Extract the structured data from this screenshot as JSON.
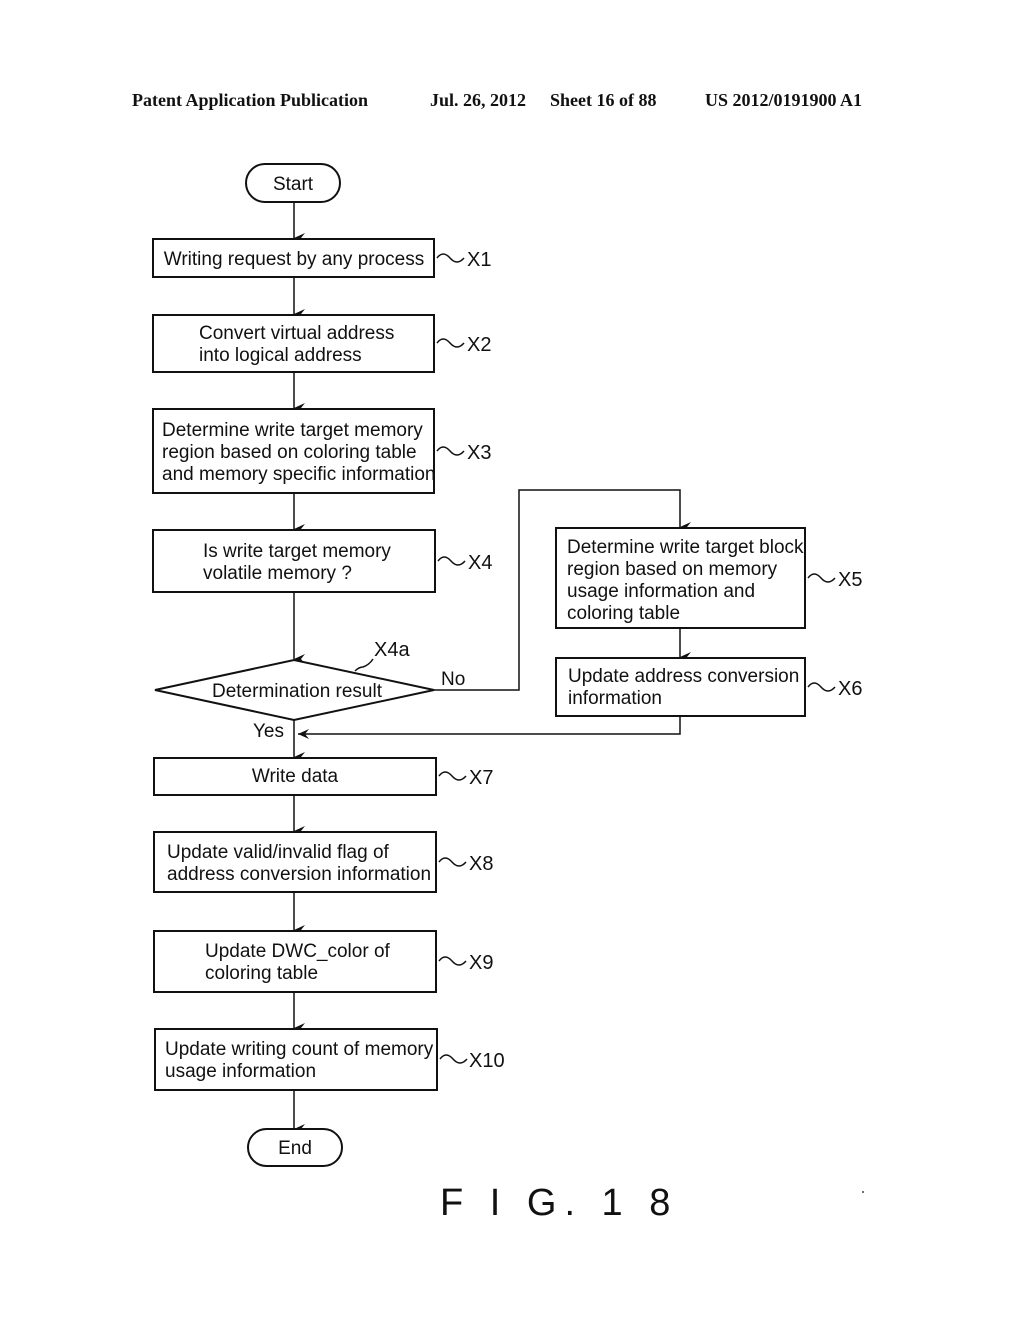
{
  "header": {
    "publication": "Patent Application Publication",
    "date": "Jul. 26, 2012",
    "sheet": "Sheet 16 of 88",
    "number": "US 2012/0191900 A1"
  },
  "flowchart": {
    "start": "Start",
    "end": "End",
    "steps": {
      "x1": {
        "ref": "X1",
        "lines": [
          "Writing request by any process"
        ]
      },
      "x2": {
        "ref": "X2",
        "lines": [
          "Convert virtual address",
          "into logical address"
        ]
      },
      "x3": {
        "ref": "X3",
        "lines": [
          "Determine write target memory",
          "region based on coloring table",
          "and memory specific information"
        ]
      },
      "x4": {
        "ref": "X4",
        "lines": [
          "Is write target memory",
          "volatile memory ?"
        ]
      },
      "x4a": {
        "ref": "X4a",
        "lines": [
          "Determination result"
        ]
      },
      "x5": {
        "ref": "X5",
        "lines": [
          "Determine write target block",
          "region based on memory",
          "usage information and",
          "coloring table"
        ]
      },
      "x6": {
        "ref": "X6",
        "lines": [
          "Update address conversion",
          "information"
        ]
      },
      "x7": {
        "ref": "X7",
        "lines": [
          "Write data"
        ]
      },
      "x8": {
        "ref": "X8",
        "lines": [
          "Update valid/invalid flag of",
          "address conversion information"
        ]
      },
      "x9": {
        "ref": "X9",
        "lines": [
          "Update DWC_color of",
          "coloring table"
        ]
      },
      "x10": {
        "ref": "X10",
        "lines": [
          "Update writing count of memory",
          "usage information"
        ]
      }
    },
    "branch_labels": {
      "no": "No",
      "yes": "Yes"
    },
    "figure_label": "F I G. 1 8"
  }
}
